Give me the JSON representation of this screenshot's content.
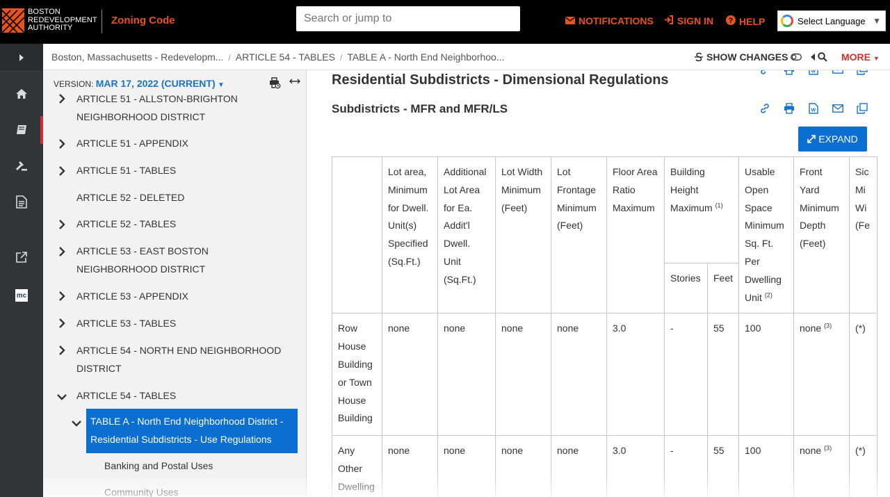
{
  "header": {
    "logo_lines": [
      "BOSTON",
      "REDEVELOPMENT",
      "AUTHORITY"
    ],
    "product": "Zoning Code",
    "search_placeholder": "Search or jump to",
    "nav": [
      {
        "label": "NOTIFICATIONS",
        "icon": "envelope-icon"
      },
      {
        "label": "SIGN IN",
        "icon": "sign-in-icon"
      },
      {
        "label": "HELP",
        "icon": "question-circle-icon"
      }
    ],
    "language": "Select Language",
    "accent": "#e8521c"
  },
  "breadcrumb": {
    "items": [
      "Boston, Massachusetts - Redevelopm...",
      "ARTICLE 54 - TABLES",
      "TABLE A - North End Neighborhoo..."
    ],
    "show_changes": "SHOW CHANGES",
    "more": "MORE"
  },
  "toc": {
    "version_label": "VERSION:",
    "version_value": "MAR 17, 2022 (CURRENT)",
    "items": [
      {
        "label": "ARTICLE 51 - ALLSTON-BRIGHTON NEIGHBORHOOD DISTRICT",
        "chevron": "right"
      },
      {
        "label": "ARTICLE 51 - APPENDIX",
        "chevron": "right"
      },
      {
        "label": "ARTICLE 51 - TABLES",
        "chevron": "right"
      },
      {
        "label": "ARTICLE 52 - DELETED",
        "chevron": "none"
      },
      {
        "label": "ARTICLE 52 - TABLES",
        "chevron": "right"
      },
      {
        "label": "ARTICLE 53 - EAST BOSTON NEIGHBORHOOD DISTRICT",
        "chevron": "right"
      },
      {
        "label": "ARTICLE 53 - APPENDIX",
        "chevron": "right"
      },
      {
        "label": "ARTICLE 53 - TABLES",
        "chevron": "right"
      },
      {
        "label": "ARTICLE 54 - NORTH END NEIGHBORHOOD DISTRICT",
        "chevron": "right"
      },
      {
        "label": "ARTICLE 54 - TABLES",
        "chevron": "down"
      }
    ],
    "selected": "TABLE A - North End Neighborhood District - Residential Subdistricts - Use Regulations",
    "sub_items": [
      "Banking and Postal Uses",
      "Community Uses"
    ]
  },
  "main": {
    "title": "Residential Subdistricts - Dimensional Regulations",
    "subtitle": "Subdistricts - MFR and MFR/LS",
    "expand_label": "EXPAND",
    "table": {
      "headers": [
        "",
        "Lot area, Minimum for Dwell. Unit(s) Specified (Sq.Ft.)",
        "Additional Lot Area for Ea. Addit'l Dwell. Unit (Sq.Ft.)",
        "Lot Width Minimum (Feet)",
        "Lot Frontage Minimum (Feet)",
        "Floor Area Ratio Maximum",
        "Building Height Maximum",
        "Usable Open Space Minimum Sq. Ft. Per Dwelling Unit",
        "Front Yard Minimum Depth (Feet)",
        "Sic Mi Wi (Fe"
      ],
      "height_note": "(1)",
      "open_space_note": "(2)",
      "sub_headers": [
        "Stories",
        "Feet"
      ],
      "rows": [
        {
          "label": "Row House Building or Town House Building",
          "cells": [
            "none",
            "none",
            "none",
            "none",
            "3.0",
            "-",
            "55",
            "100",
            "none",
            "(*)"
          ],
          "front_note": "(3)"
        },
        {
          "label": "Any Other Dwelling",
          "cells": [
            "none",
            "none",
            "none",
            "none",
            "3.0",
            "-",
            "55",
            "100",
            "none",
            "(*)"
          ],
          "front_note": "(3)"
        }
      ]
    }
  }
}
